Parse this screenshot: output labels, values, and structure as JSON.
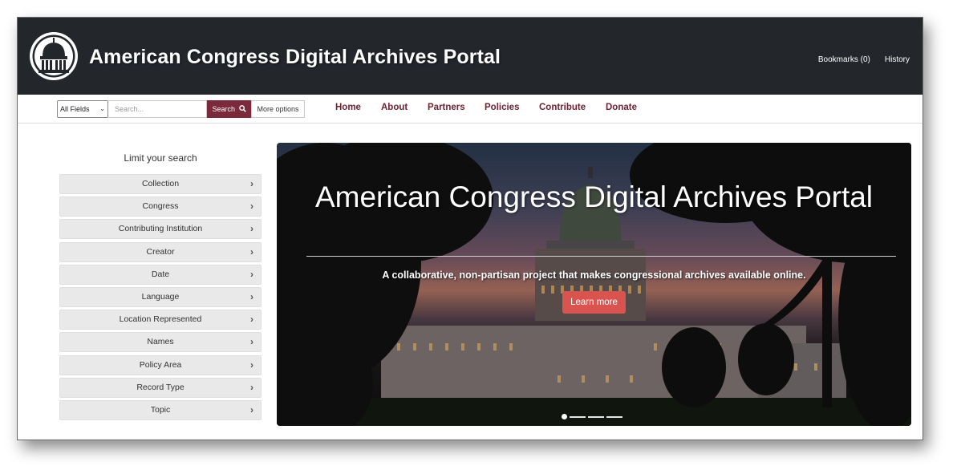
{
  "header": {
    "logo": "capitol-dome-icon",
    "title": "American Congress Digital Archives Portal",
    "links": [
      "Bookmarks (0)",
      "History"
    ]
  },
  "search": {
    "field_selected": "All Fields",
    "placeholder": "Search...",
    "button_label": "Search",
    "more_options_label": "More options"
  },
  "nav": {
    "items": [
      "Home",
      "About",
      "Partners",
      "Policies",
      "Contribute",
      "Donate"
    ]
  },
  "sidebar": {
    "title": "Limit your search",
    "facets": [
      "Collection",
      "Congress",
      "Contributing Institution",
      "Creator",
      "Date",
      "Language",
      "Location Represented",
      "Names",
      "Policy Area",
      "Record Type",
      "Topic"
    ]
  },
  "hero": {
    "title": "American Congress Digital Archives Portal",
    "subtitle": "A collaborative, non-partisan project that makes congressional archives available online.",
    "button_label": "Learn more",
    "slide_count": 4,
    "active_slide": 1
  },
  "colors": {
    "header_bg": "#23272c",
    "nav_link": "#6e2333",
    "search_button": "#7a2a3a",
    "learn_more_button": "#d9534f"
  }
}
